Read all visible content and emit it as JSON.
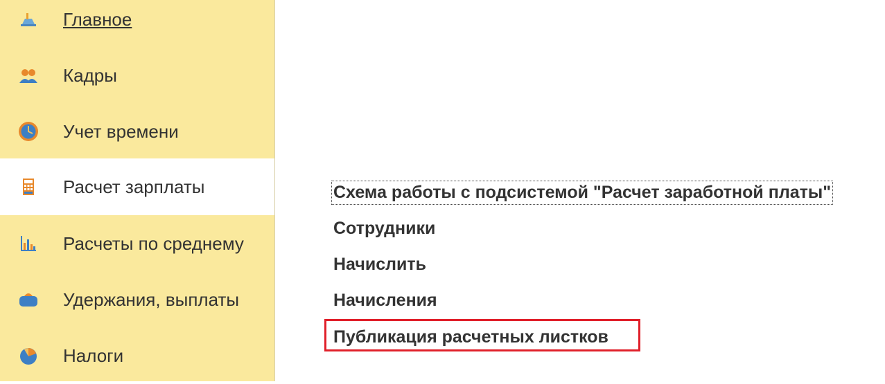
{
  "sidebar": {
    "items": [
      {
        "label": "Главное",
        "icon": "home-desk-icon",
        "active": false,
        "underlined": true
      },
      {
        "label": "Кадры",
        "icon": "people-icon",
        "active": false,
        "underlined": false
      },
      {
        "label": "Учет времени",
        "icon": "clock-icon",
        "active": false,
        "underlined": false
      },
      {
        "label": "Расчет зарплаты",
        "icon": "calculator-icon",
        "active": true,
        "underlined": false
      },
      {
        "label": "Расчеты по среднему",
        "icon": "bar-chart-icon",
        "active": false,
        "underlined": false
      },
      {
        "label": "Удержания, выплаты",
        "icon": "wallet-icon",
        "active": false,
        "underlined": false
      },
      {
        "label": "Налоги",
        "icon": "pie-chart-icon",
        "active": false,
        "underlined": false
      }
    ]
  },
  "content": {
    "commands": [
      {
        "label": "Схема работы с подсистемой \"Расчет заработной платы\"",
        "focused": true
      },
      {
        "label": "Сотрудники",
        "focused": false
      },
      {
        "label": "Начислить",
        "focused": false
      },
      {
        "label": "Начисления",
        "focused": false
      },
      {
        "label": "Публикация расчетных листков",
        "focused": false,
        "highlighted": true
      }
    ]
  },
  "colors": {
    "sidebar_bg": "#fae99d",
    "active_item_bg": "#ffffff",
    "highlight_border": "#e0202a",
    "text": "#333333"
  }
}
